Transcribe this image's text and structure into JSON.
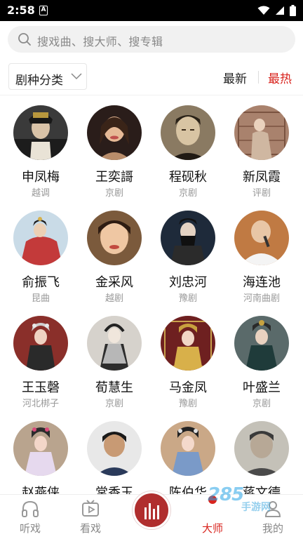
{
  "status_bar": {
    "time": "2:58",
    "notification_glyph": "A",
    "icons": [
      "wifi-icon",
      "signal-icon",
      "battery-icon"
    ]
  },
  "search": {
    "placeholder": "搜戏曲、搜大师、搜专辑"
  },
  "filter": {
    "genre_label": "剧种分类",
    "sort_newest": "最新",
    "sort_hottest": "最热",
    "active_sort": "最热"
  },
  "artists": [
    {
      "name": "申凤梅",
      "genre": "越调"
    },
    {
      "name": "王奕謌",
      "genre": "京剧"
    },
    {
      "name": "程砚秋",
      "genre": "京剧"
    },
    {
      "name": "新凤霞",
      "genre": "评剧"
    },
    {
      "name": "俞振飞",
      "genre": "昆曲"
    },
    {
      "name": "金采风",
      "genre": "越剧"
    },
    {
      "name": "刘忠河",
      "genre": "豫剧"
    },
    {
      "name": "海连池",
      "genre": "河南曲剧"
    },
    {
      "name": "王玉磬",
      "genre": "河北梆子"
    },
    {
      "name": "荀慧生",
      "genre": "京剧"
    },
    {
      "name": "马金凤",
      "genre": "豫剧"
    },
    {
      "name": "叶盛兰",
      "genre": "京剧"
    },
    {
      "name": "赵燕侠",
      "genre": ""
    },
    {
      "name": "常香玉",
      "genre": ""
    },
    {
      "name": "陈伯华",
      "genre": ""
    },
    {
      "name": "蒋文德",
      "genre": ""
    }
  ],
  "nav": {
    "listen": "听戏",
    "watch": "看戏",
    "masters": "大师",
    "mine": "我的",
    "active": "大师"
  },
  "watermark": {
    "main": "285",
    "sub": "手游网"
  },
  "colors": {
    "accent": "#d8241e",
    "center_button": "#b02e2e"
  }
}
